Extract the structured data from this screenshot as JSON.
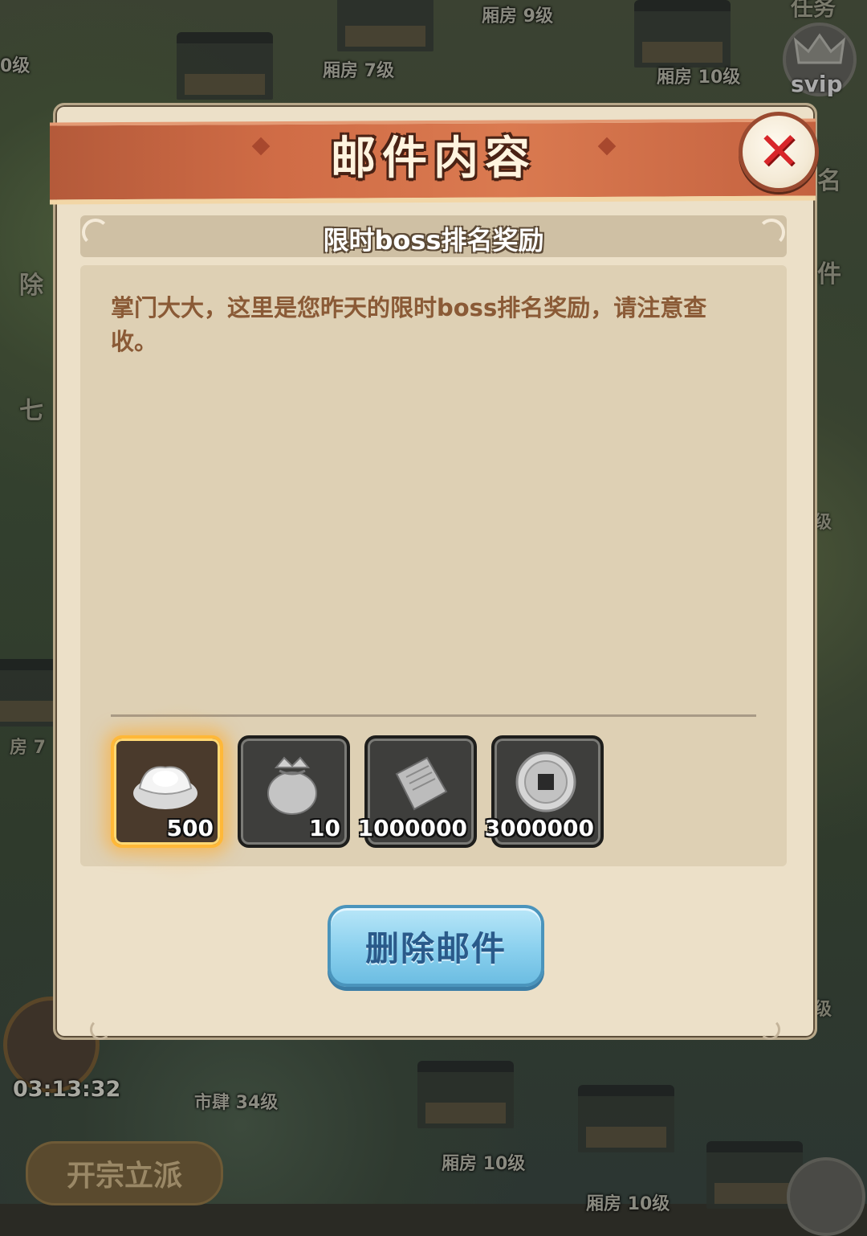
{
  "background": {
    "map_labels": [
      "厢房 9级",
      "厢房 7级",
      "厢房 10级",
      "市肆 34级",
      "厢房 10级",
      "厢房 10级",
      "0级"
    ],
    "side_fragments": [
      "除",
      "七",
      "房 7",
      "级",
      "名",
      "件",
      "级"
    ],
    "svip_label": "svip",
    "timer": "03:13:32",
    "sect_button_label": "开宗立派",
    "partial_top_right": "任务"
  },
  "modal": {
    "title": "邮件内容",
    "close_icon": "close-x-icon",
    "subject": "限时boss排名奖励",
    "body": "掌门大大，这里是您昨天的限时boss排名奖励，请注意查收。",
    "attachments": [
      {
        "name": "silver-ingot",
        "icon": "silver-ingot-icon",
        "count": "500",
        "highlighted": true
      },
      {
        "name": "pouch",
        "icon": "pouch-icon",
        "count": "10",
        "highlighted": false
      },
      {
        "name": "scroll",
        "icon": "scroll-icon",
        "count": "1000000",
        "highlighted": false
      },
      {
        "name": "coin",
        "icon": "coin-icon",
        "count": "3000000",
        "highlighted": false
      }
    ],
    "delete_button_label": "删除邮件"
  },
  "colors": {
    "title_bar": "#d06c46",
    "body_text": "#8a5a36",
    "delete_button": "#8ad0ee",
    "close_x": "#d8262a",
    "highlight_glow": "#ffb838"
  }
}
